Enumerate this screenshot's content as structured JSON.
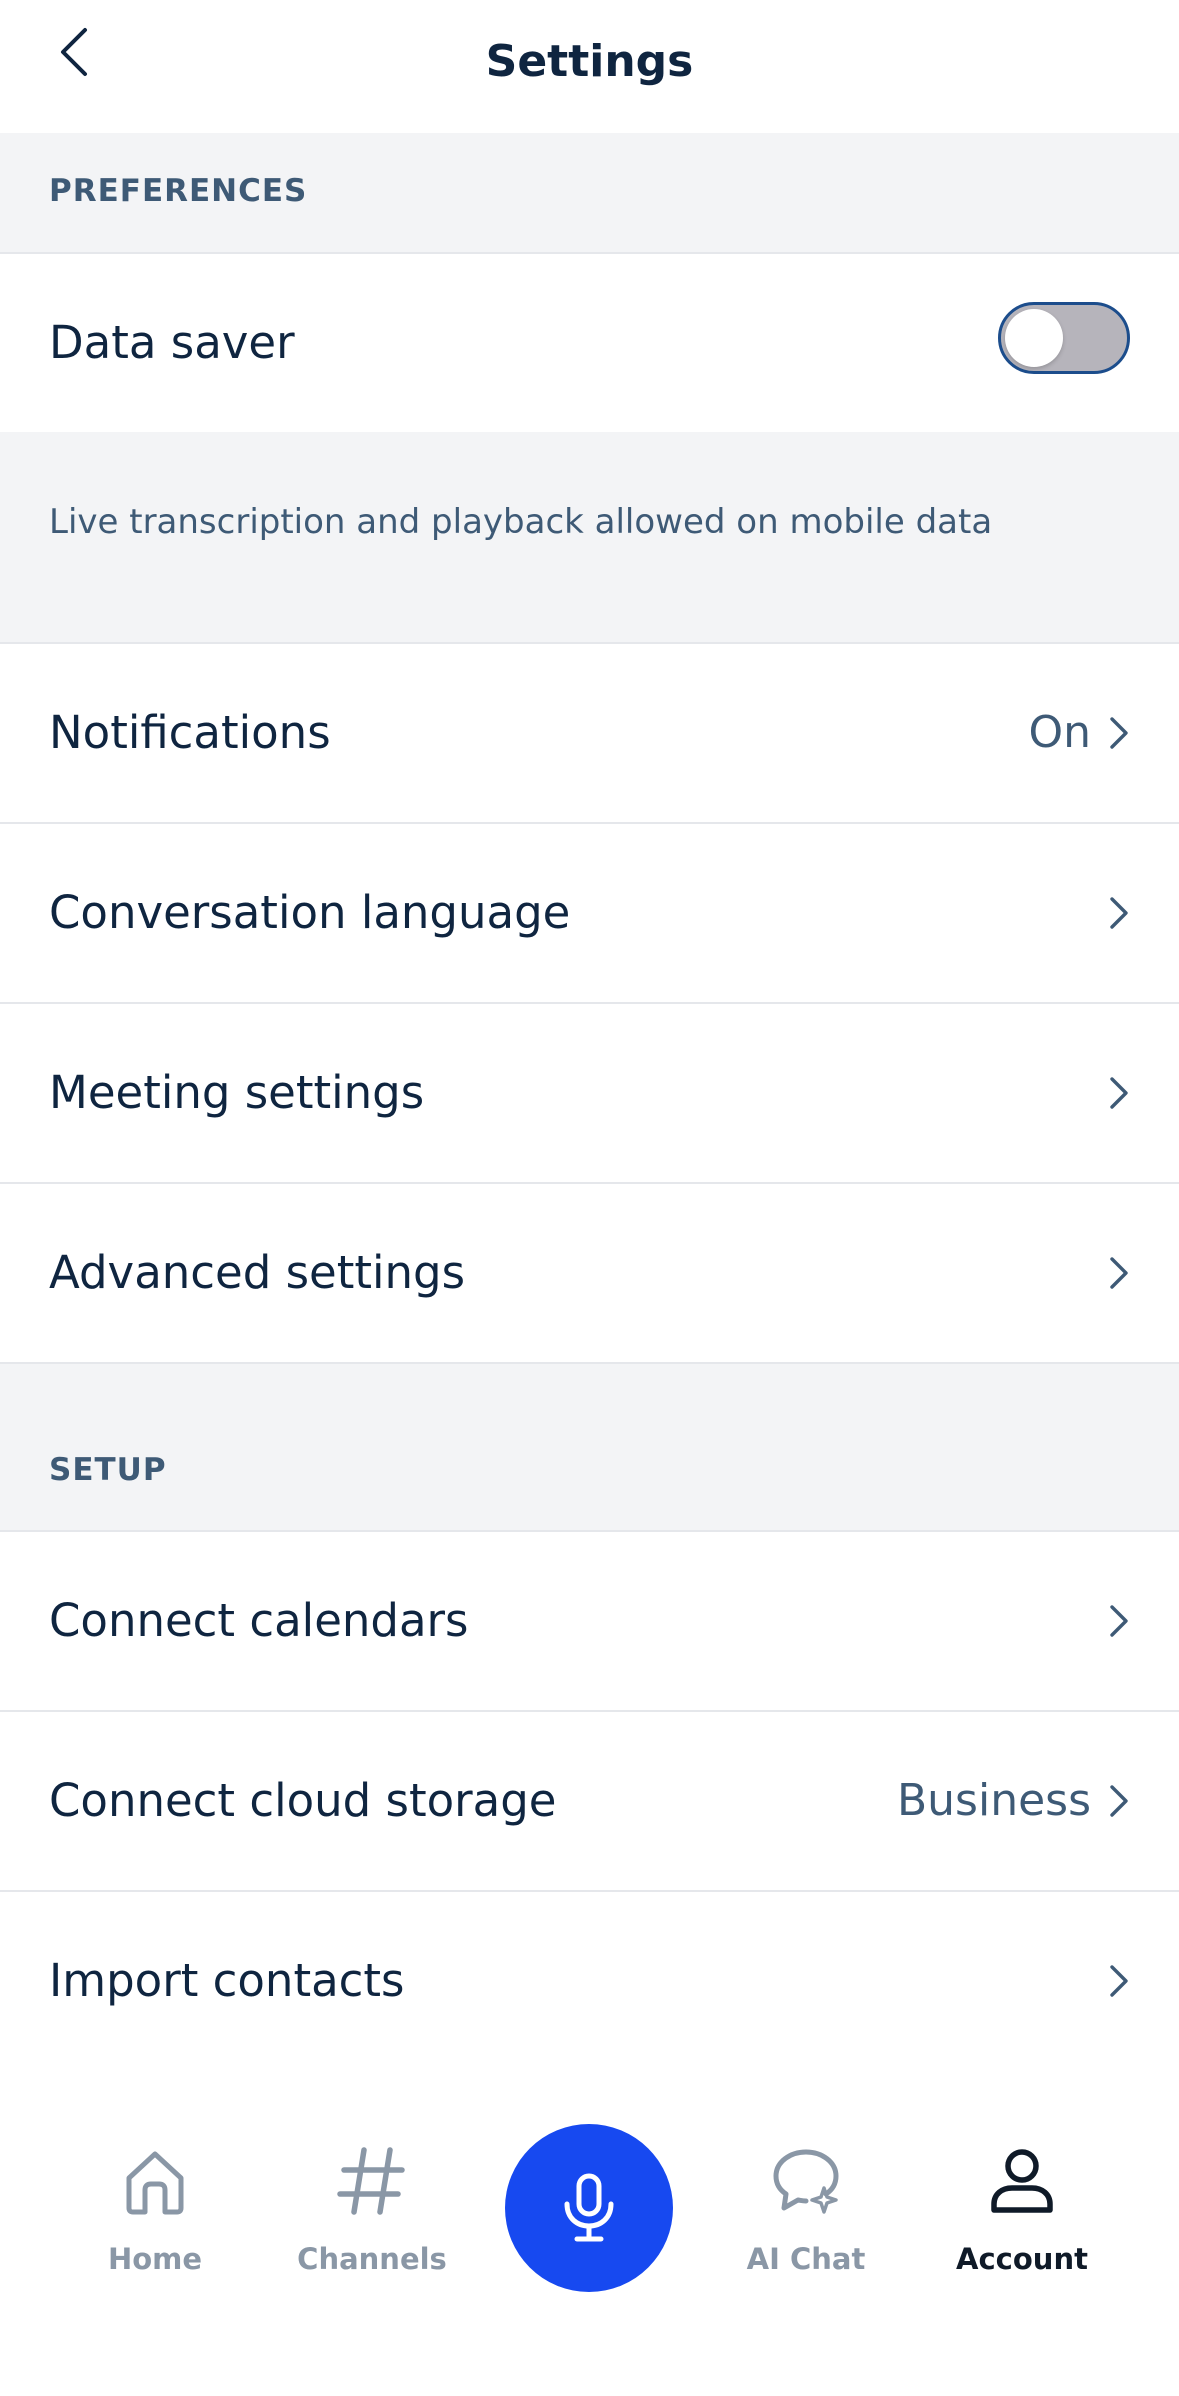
{
  "header": {
    "title": "Settings"
  },
  "preferences": {
    "section_label": "PREFERENCES",
    "data_saver": {
      "label": "Data saver",
      "enabled": false
    },
    "data_saver_hint": "Live transcription and playback allowed on mobile data",
    "notifications": {
      "label": "Notifications",
      "value": "On"
    },
    "conversation_language": {
      "label": "Conversation language"
    },
    "meeting_settings": {
      "label": "Meeting settings"
    },
    "advanced_settings": {
      "label": "Advanced settings"
    }
  },
  "setup": {
    "section_label": "SETUP",
    "connect_calendars": {
      "label": "Connect calendars"
    },
    "connect_cloud_storage": {
      "label": "Connect cloud storage",
      "value": "Business"
    },
    "import_contacts": {
      "label": "Import contacts"
    }
  },
  "tabbar": {
    "home": {
      "label": "Home",
      "icon": "home-icon"
    },
    "channels": {
      "label": "Channels",
      "icon": "hash-icon"
    },
    "record": {
      "icon": "microphone-icon"
    },
    "ai_chat": {
      "label": "AI Chat",
      "icon": "chat-sparkle-icon"
    },
    "account": {
      "label": "Account",
      "icon": "person-icon",
      "active": true
    }
  },
  "colors": {
    "primary_text": "#0f2540",
    "secondary_text": "#3e5a76",
    "section_background": "#f3f4f6",
    "accent": "#1749f0",
    "tab_inactive": "#8a97a6",
    "tab_active": "#0f1a28"
  }
}
